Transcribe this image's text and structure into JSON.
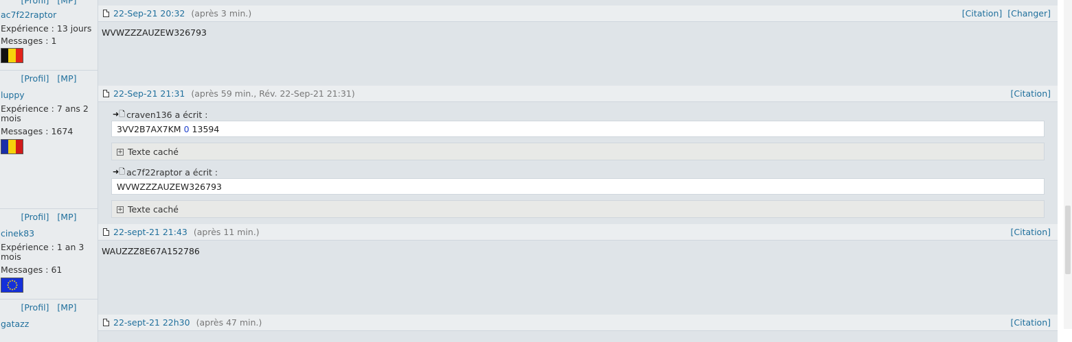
{
  "top_links": {
    "profil": "[Profil]",
    "mp": "[MP]"
  },
  "posts": [
    {
      "user": "ac7f22raptor",
      "experience": "Expérience : 13 jours",
      "messages": "Messages : 1",
      "flag": "belgium-flag",
      "profil": "[Profil]",
      "mp": "[MP]",
      "date": "22-Sep-21 20:32",
      "meta": "(après 3 min.)",
      "actions": [
        "[Citation]",
        "[Changer]"
      ],
      "text": "WVWZZZAUZEW326793"
    },
    {
      "user": "luppy",
      "experience": "Expérience : 7 ans 2 mois",
      "messages": "Messages : 1674",
      "flag": "romania-flag",
      "profil": "[Profil]",
      "mp": "[MP]",
      "date": "22-Sep-21 21:31",
      "meta": "(après 59 min., Rév. 22-Sep-21 21:31)",
      "actions": [
        "[Citation]"
      ],
      "quotes": [
        {
          "author": "craven136 a écrit :",
          "text_a": "3VV2B7AX7KM",
          "text_b": "0",
          "text_c": "13594",
          "hidden": "Texte caché"
        },
        {
          "author": "ac7f22raptor a écrit :",
          "text_a": "WVWZZZAUZEW326793",
          "hidden": "Texte caché"
        }
      ]
    },
    {
      "user": "cinek83",
      "experience": "Expérience : 1 an 3 mois",
      "messages": "Messages : 61",
      "flag": "eu-flag",
      "profil": "[Profil]",
      "mp": "[MP]",
      "date": "22-sept-21 21:43",
      "meta": "(après 11 min.)",
      "actions": [
        "[Citation]"
      ],
      "text": "WAUZZZ8E67A152786"
    },
    {
      "user": "gatazz",
      "date": "22-sept-21 22h30",
      "meta": "(après 47 min.)",
      "actions": [
        "[Citation]"
      ]
    }
  ],
  "colors": {
    "link": "#1f6f9c",
    "sidebar": "#e9ecee",
    "post_bg": "#dfe4e8",
    "header_bg": "#ebeef0"
  }
}
